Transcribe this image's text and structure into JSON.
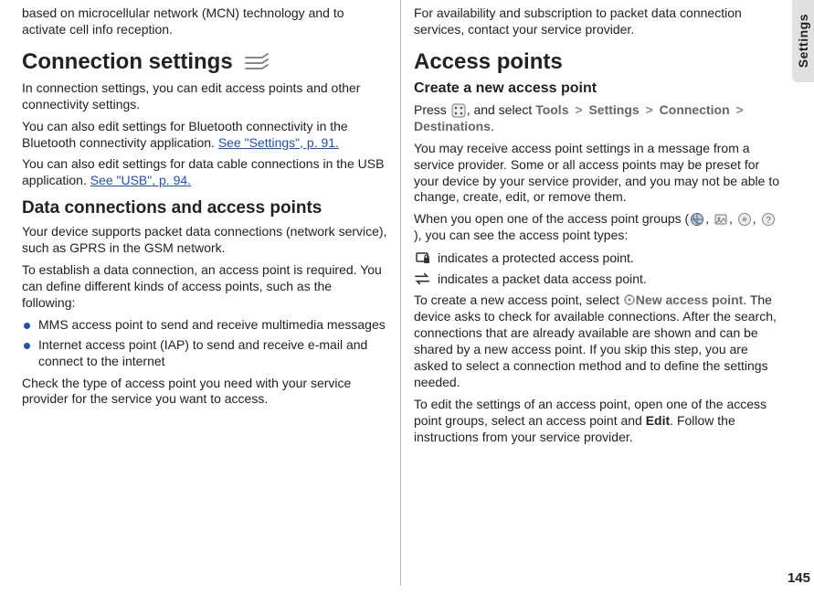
{
  "side_tab": "Settings",
  "page_number": "145",
  "left": {
    "intro_frag": "based on microcellular network (MCN) technology and to activate cell info reception.",
    "h_connection": "Connection settings",
    "conn_p1": "In connection settings, you can edit access points and other connectivity settings.",
    "conn_p2a": "You can also edit settings for Bluetooth connectivity in the Bluetooth connectivity application. ",
    "conn_p2_link": "See \"Settings\", p. 91.",
    "conn_p3a": "You can also edit settings for data cable connections in the USB application. ",
    "conn_p3_link": "See \"USB\", p. 94.",
    "h_data": "Data connections and access points",
    "data_p1": "Your device supports packet data connections (network service), such as GPRS in the GSM network.",
    "data_p2": "To establish a data connection, an access point is required. You can define different kinds of access points, such as the following:",
    "bullets": [
      "MMS access point to send and receive multimedia messages",
      "Internet access point (IAP) to send and receive e-mail and connect to the internet"
    ],
    "data_p3": "Check the type of access point you need with your service provider for the service you want to access."
  },
  "right": {
    "top_p": "For availability and subscription to packet data connection services, contact your service provider.",
    "h_ap": "Access points",
    "h_create": "Create a new access point",
    "press_pre": "Press ",
    "press_post": ", and select ",
    "nav": {
      "tools": "Tools",
      "settings": "Settings",
      "connection": "Connection",
      "destinations": "Destinations"
    },
    "sep": ">",
    "period": ".",
    "p_receive": "You may receive access point settings in a message from a service provider. Some or all access points may be preset for your device by your service provider, and you may not be able to change, create, edit, or remove them.",
    "p_open_pre": "When you open one of the access point groups (",
    "p_open_mid": ", ",
    "p_open_post": "), you can see the access point types:",
    "ind_protected": " indicates a protected access point.",
    "ind_packet": " indicates a packet data access point.",
    "p_create_pre": "To create a new access point, select ",
    "new_ap": "New access point",
    "p_create_post": ". The device asks to check for available connections. After the search, connections that are already available are shown and can be shared by a new access point. If you skip this step, you are asked to select a connection method and to define the settings needed.",
    "p_edit_pre": "To edit the settings of an access point, open one of the access point groups, select an access point and ",
    "edit": "Edit",
    "p_edit_post": ". Follow the instructions from your service provider."
  }
}
